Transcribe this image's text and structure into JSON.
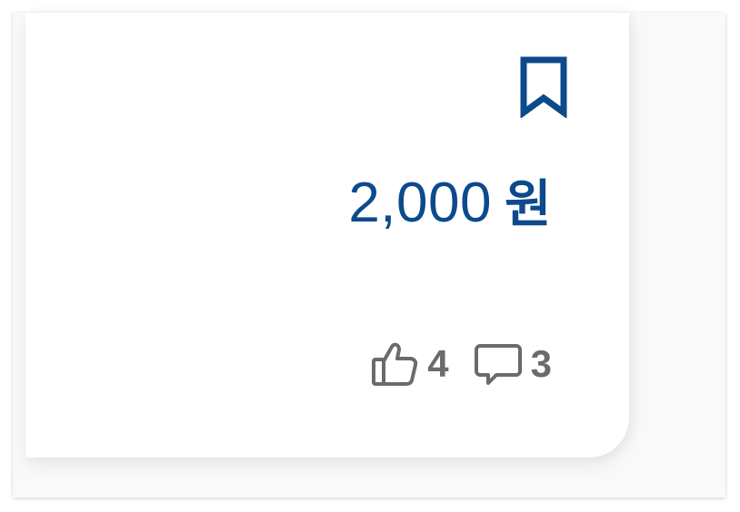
{
  "card": {
    "bookmark_icon": "bookmark-icon",
    "price": {
      "amount": "2,000",
      "currency": "원",
      "color": "#0c4a8c"
    },
    "stats": {
      "likes": {
        "icon": "thumbs-up-icon",
        "count": "4"
      },
      "comments": {
        "icon": "speech-bubble-icon",
        "count": "3"
      },
      "color": "#6b6b6b"
    }
  }
}
